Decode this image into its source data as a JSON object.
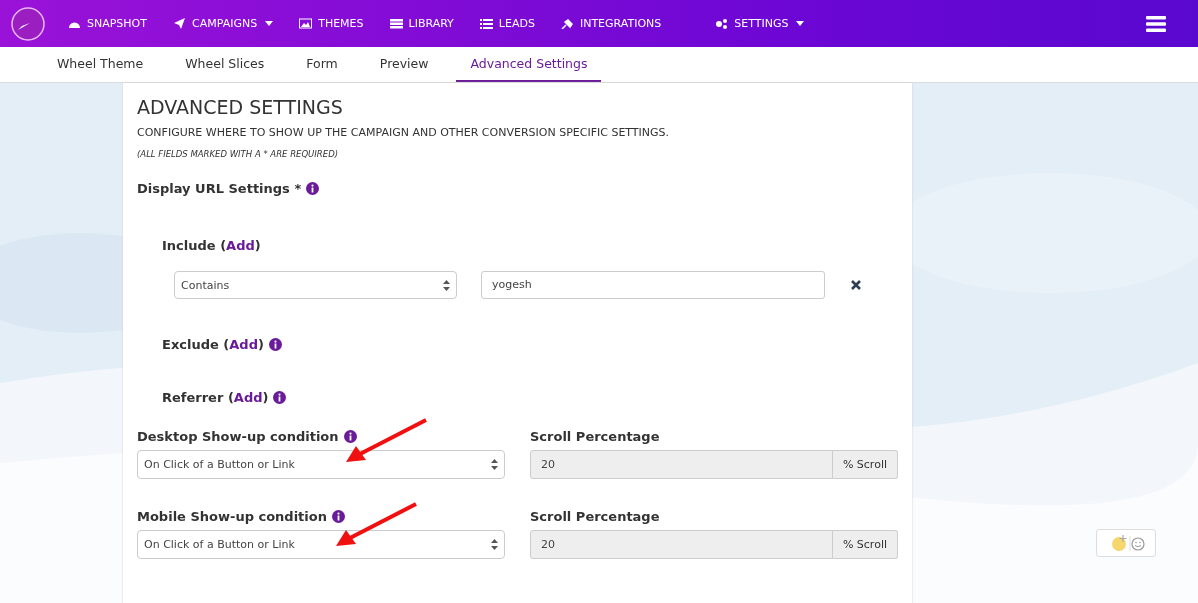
{
  "nav": {
    "items": [
      {
        "label": "SNAPSHOT",
        "caret": false
      },
      {
        "label": "CAMPAIGNS",
        "caret": true
      },
      {
        "label": "THEMES",
        "caret": false
      },
      {
        "label": "LIBRARY",
        "caret": false
      },
      {
        "label": "LEADS",
        "caret": false
      },
      {
        "label": "INTEGRATIONS",
        "caret": false
      },
      {
        "label": "SETTINGS",
        "caret": true
      }
    ]
  },
  "tabs": [
    {
      "label": "Wheel Theme",
      "selected": false
    },
    {
      "label": "Wheel Slices",
      "selected": false
    },
    {
      "label": "Form",
      "selected": false
    },
    {
      "label": "Preview",
      "selected": false
    },
    {
      "label": "Advanced Settings",
      "selected": true
    }
  ],
  "panel": {
    "title": "ADVANCED SETTINGS",
    "subtitle": "CONFIGURE WHERE TO SHOW UP THE CAMPAIGN AND OTHER CONVERSION SPECIFIC SETTINGS.",
    "note": "(ALL FIELDS MARKED WITH A * ARE REQUIRED)",
    "display_url": {
      "label": "Display URL Settings *"
    },
    "groups": [
      {
        "label": "Include (",
        "link": "Add",
        "close": ")",
        "info": false,
        "rules": [
          {
            "match": "Contains",
            "value": "yogesh"
          }
        ]
      },
      {
        "label": "Exclude (",
        "link": "Add",
        "close": ")",
        "info": true
      },
      {
        "label": "Referrer (",
        "link": "Add",
        "close": ")",
        "info": true
      }
    ],
    "conditions": [
      {
        "label": "Desktop Show-up condition",
        "select": "On Click of a Button or Link",
        "scroll_label": "Scroll Percentage",
        "scroll_value": "20",
        "addon": "% Scroll",
        "disabled": true
      },
      {
        "label": "Mobile Show-up condition",
        "select": "On Click of a Button or Link",
        "scroll_label": "Scroll Percentage",
        "scroll_value": "20",
        "addon": "% Scroll",
        "disabled": true
      }
    ]
  }
}
